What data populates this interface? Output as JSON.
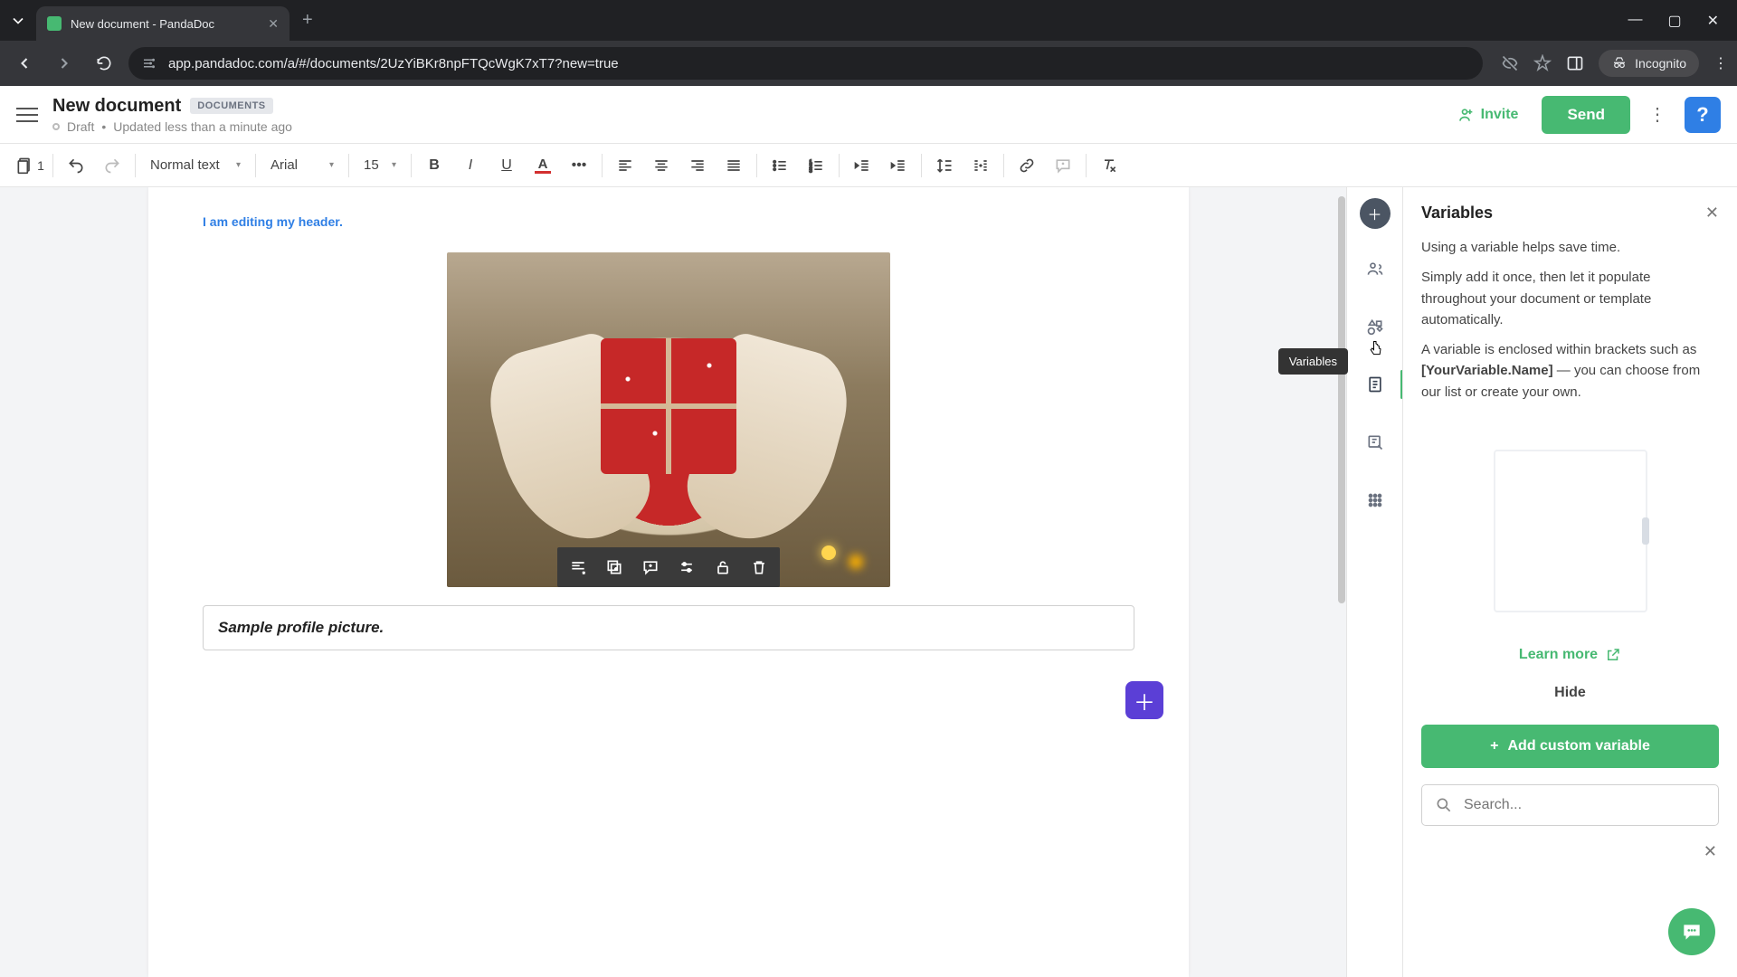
{
  "browser": {
    "tab_title": "New document - PandaDoc",
    "url": "app.pandadoc.com/a/#/documents/2UzYiBKr8npFTQcWgK7xT7?new=true",
    "incognito_label": "Incognito"
  },
  "header": {
    "doc_title": "New document",
    "badge": "DOCUMENTS",
    "status_label": "Draft",
    "status_separator": "•",
    "updated": "Updated less than a minute ago",
    "invite_label": "Invite",
    "send_label": "Send"
  },
  "toolbar": {
    "pages": "1",
    "style_select": "Normal text",
    "font_select": "Arial",
    "font_size": "15"
  },
  "document": {
    "header_text": "I am editing my header.",
    "caption": "Sample profile picture."
  },
  "rail_tooltip": "Variables",
  "variables_panel": {
    "title": "Variables",
    "intro": "Using a variable helps save time.",
    "p1": "Simply add it once, then let it populate throughout your document or template automatically.",
    "p2_a": "A variable is enclosed within brackets such as ",
    "p2_bold": "[YourVariable.Name]",
    "p2_b": " — you can choose from our list or create your own.",
    "learn_more": "Learn more",
    "hide": "Hide",
    "add_button": "Add custom variable",
    "search_placeholder": "Search..."
  }
}
